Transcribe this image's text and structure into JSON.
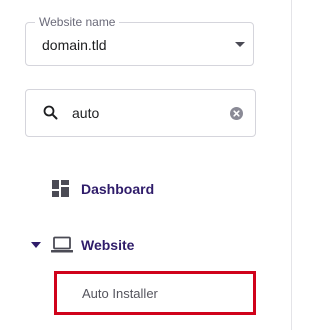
{
  "website_select": {
    "label": "Website name",
    "value": "domain.tld"
  },
  "search": {
    "value": "auto",
    "placeholder": ""
  },
  "navigation": {
    "items": [
      {
        "label": "Dashboard",
        "icon": "dashboard-icon"
      },
      {
        "label": "Website",
        "icon": "laptop-icon",
        "expanded": true,
        "children": [
          {
            "label": "Auto Installer",
            "highlighted": true
          }
        ]
      }
    ]
  },
  "colors": {
    "nav_text": "#2f1c6a",
    "highlight_border": "#d0021b",
    "border": "#d5d5dc"
  }
}
